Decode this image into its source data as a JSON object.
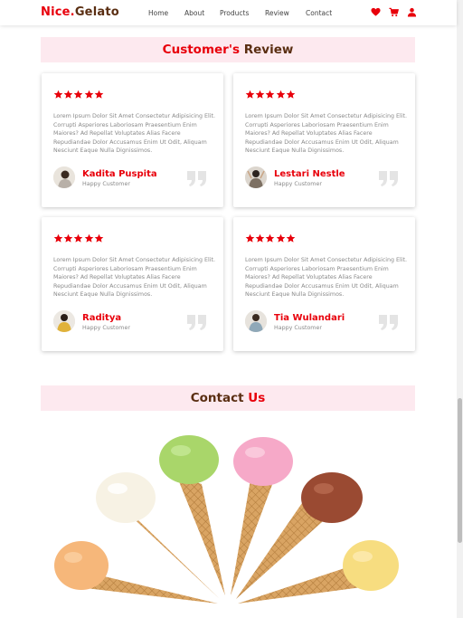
{
  "navbar": {
    "brand_part1": "Nice.",
    "brand_part2": "Gelato",
    "links": [
      "Home",
      "About",
      "Products",
      "Review",
      "Contact"
    ],
    "icons": [
      "heart-icon",
      "cart-icon",
      "user-icon"
    ]
  },
  "review_section": {
    "title_part1": "Customer's",
    "title_part2": "Review",
    "cards": [
      {
        "rating": 5,
        "text": "Lorem Ipsum Dolor Sit Amet Consectetur Adipisicing Elit. Corrupti Asperiores Laboriosam Praesentium Enim Maiores? Ad Repellat Voluptates Alias Facere Repudiandae Dolor Accusamus Enim Ut Odit, Aliquam Nesciunt Eaque Nulla Dignissimos.",
        "name": "Kadita Puspita",
        "role": "Happy Customer"
      },
      {
        "rating": 5,
        "text": "Lorem Ipsum Dolor Sit Amet Consectetur Adipisicing Elit. Corrupti Asperiores Laboriosam Praesentium Enim Maiores? Ad Repellat Voluptates Alias Facere Repudiandae Dolor Accusamus Enim Ut Odit, Aliquam Nesciunt Eaque Nulla Dignissimos.",
        "name": "Lestari Nestle",
        "role": "Happy Customer"
      },
      {
        "rating": 5,
        "text": "Lorem Ipsum Dolor Sit Amet Consectetur Adipisicing Elit. Corrupti Asperiores Laboriosam Praesentium Enim Maiores? Ad Repellat Voluptates Alias Facere Repudiandae Dolor Accusamus Enim Ut Odit, Aliquam Nesciunt Eaque Nulla Dignissimos.",
        "name": "Raditya",
        "role": "Happy Customer"
      },
      {
        "rating": 5,
        "text": "Lorem Ipsum Dolor Sit Amet Consectetur Adipisicing Elit. Corrupti Asperiores Laboriosam Praesentium Enim Maiores? Ad Repellat Voluptates Alias Facere Repudiandae Dolor Accusamus Enim Ut Odit, Aliquam Nesciunt Eaque Nulla Dignissimos.",
        "name": "Tia Wulandari",
        "role": "Happy Customer"
      }
    ]
  },
  "contact_section": {
    "title_part1": "Contact",
    "title_part2": "Us"
  },
  "colors": {
    "accent_red": "#e8000b",
    "brand_brown": "#5a2e12",
    "section_bg": "#fde9ef"
  }
}
